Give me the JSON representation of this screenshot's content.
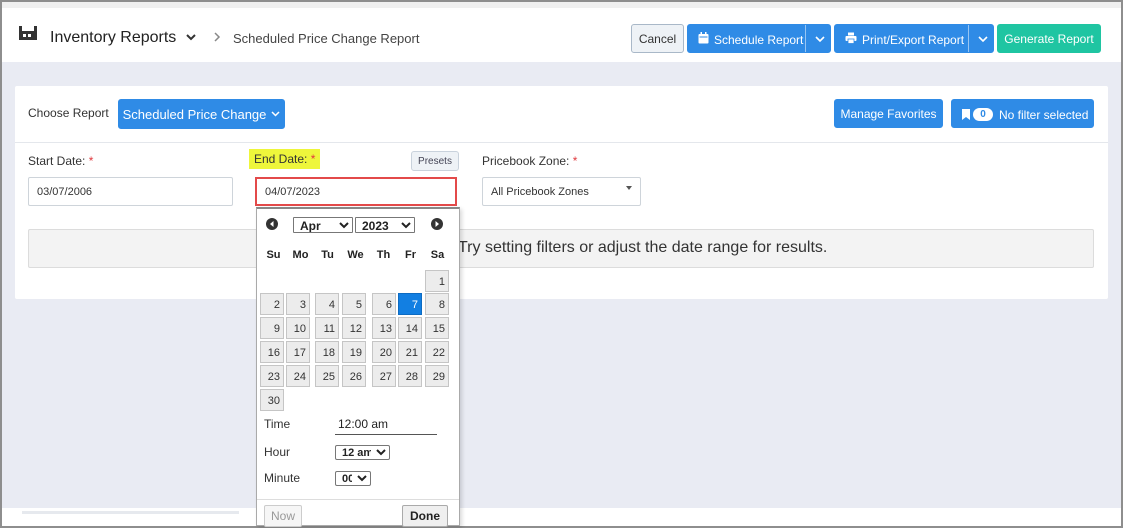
{
  "header": {
    "app_title": "Inventory Reports",
    "breadcrumb_current": "Scheduled Price Change Report",
    "app_icon": "factory-icon",
    "cancel_label": "Cancel",
    "schedule_label": "Schedule Report",
    "print_label": "Print/Export Report",
    "generate_label": "Generate Report"
  },
  "toolbar": {
    "choose_report_label": "Choose Report",
    "report_selected": "Scheduled Price Change",
    "manage_favorites_label": "Manage Favorites",
    "filter_count": "0",
    "filter_label": "No filter selected"
  },
  "filters": {
    "start_date_label": "Start Date:",
    "start_date_value": "03/07/2006",
    "end_date_label": "End Date:",
    "end_date_value": "04/07/2023",
    "presets_label": "Presets",
    "pricebook_label": "Pricebook Zone:",
    "pricebook_value": "All Pricebook Zones",
    "required_mark": "*"
  },
  "empty_message": "Try setting filters or adjust the date range for results.",
  "datepicker": {
    "month": "Apr",
    "year": "2023",
    "weekdays": [
      "Su",
      "Mo",
      "Tu",
      "We",
      "Th",
      "Fr",
      "Sa"
    ],
    "days": [
      "1",
      "2",
      "3",
      "4",
      "5",
      "6",
      "7",
      "8",
      "9",
      "10",
      "11",
      "12",
      "13",
      "14",
      "15",
      "16",
      "17",
      "18",
      "19",
      "20",
      "21",
      "22",
      "23",
      "24",
      "25",
      "26",
      "27",
      "28",
      "29",
      "30"
    ],
    "selected_day": "7",
    "time_label": "Time",
    "time_value": "12:00 am",
    "hour_label": "Hour",
    "hour_value": "12 am",
    "minute_label": "Minute",
    "minute_value": "00",
    "now_label": "Now",
    "done_label": "Done"
  },
  "colors": {
    "primary": "#2f8be6",
    "generate": "#1fc5a2",
    "highlight": "#eef63b",
    "required": "#e0393e",
    "selected_day": "#127fe2"
  }
}
